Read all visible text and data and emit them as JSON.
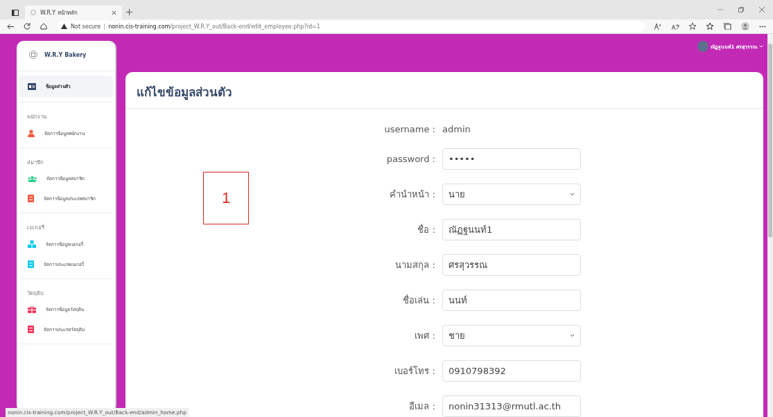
{
  "browser": {
    "tab_title": "W.R.Y หน้าหลัก",
    "security": "Not secure",
    "url_host": "nonin.cis-training.com",
    "url_path": "/project_W.R.Y_out/Back-end/edit_employee.php?id=1",
    "status_url": "nonin.cis-training.com/project_W.R.Y_out/Back-end/admin_home.php"
  },
  "sidebar": {
    "brand": "W.R.Y Bakery",
    "sections": [
      {
        "items": [
          {
            "label": "ข้อมูลส่วนตัว",
            "kind": "id-card",
            "color": "#344767",
            "selected": true
          }
        ]
      },
      {
        "heading": "พนักงาน",
        "items": [
          {
            "label": "จัดการข้อมูลพนักงาน",
            "kind": "person",
            "color": "#f5593d",
            "selected": false
          }
        ]
      },
      {
        "heading": "สมาชิก",
        "items": [
          {
            "label": "จัดการข้อมูลสมาชิก",
            "kind": "group",
            "color": "#2dce89",
            "selected": false
          },
          {
            "label": "จัดการข้อมูลประเภทสมาชิก",
            "kind": "book",
            "color": "#f5593d",
            "selected": false
          }
        ]
      },
      {
        "heading": "เบเกอรี่",
        "items": [
          {
            "label": "จัดการข้อมูลเบเกอรี่",
            "kind": "boxes",
            "color": "#11cdef",
            "selected": false
          },
          {
            "label": "จัดการประเภทเบเกอรี่",
            "kind": "book",
            "color": "#11cdef",
            "selected": false
          }
        ]
      },
      {
        "heading": "วัตถุดิบ",
        "items": [
          {
            "label": "จัดการข้อมูลวัตถุดิบ",
            "kind": "gift",
            "color": "#f5365c",
            "selected": false
          },
          {
            "label": "จัดการประเภทวัตถุดิบ",
            "kind": "book",
            "color": "#f5365c",
            "selected": false
          }
        ]
      }
    ]
  },
  "topbar": {
    "user_name": "ณัฏฐนนท์1 ศรสุวรรณ"
  },
  "page": {
    "title": "แก้ไขข้อมูลส่วนตัว",
    "annotation": "1",
    "fields": [
      {
        "kind": "static",
        "label": "username :",
        "value": "admin"
      },
      {
        "kind": "password",
        "label": "password :",
        "value": "•••••"
      },
      {
        "kind": "select",
        "label": "คำนำหน้า :",
        "value": "นาย"
      },
      {
        "kind": "input",
        "label": "ชื่อ :",
        "value": "ณัฏฐนนท์1"
      },
      {
        "kind": "input",
        "label": "นามสกุล :",
        "value": "ศรสุวรรณ"
      },
      {
        "kind": "input",
        "label": "ชื่อเล่น :",
        "value": "นนท์"
      },
      {
        "kind": "select",
        "label": "เพศ :",
        "value": "ชาย"
      },
      {
        "kind": "input",
        "label": "เบอร์โทร :",
        "value": "0910798392"
      },
      {
        "kind": "input",
        "label": "อีเมล :",
        "value": "nonin31313@rmutl.ac.th"
      }
    ]
  }
}
